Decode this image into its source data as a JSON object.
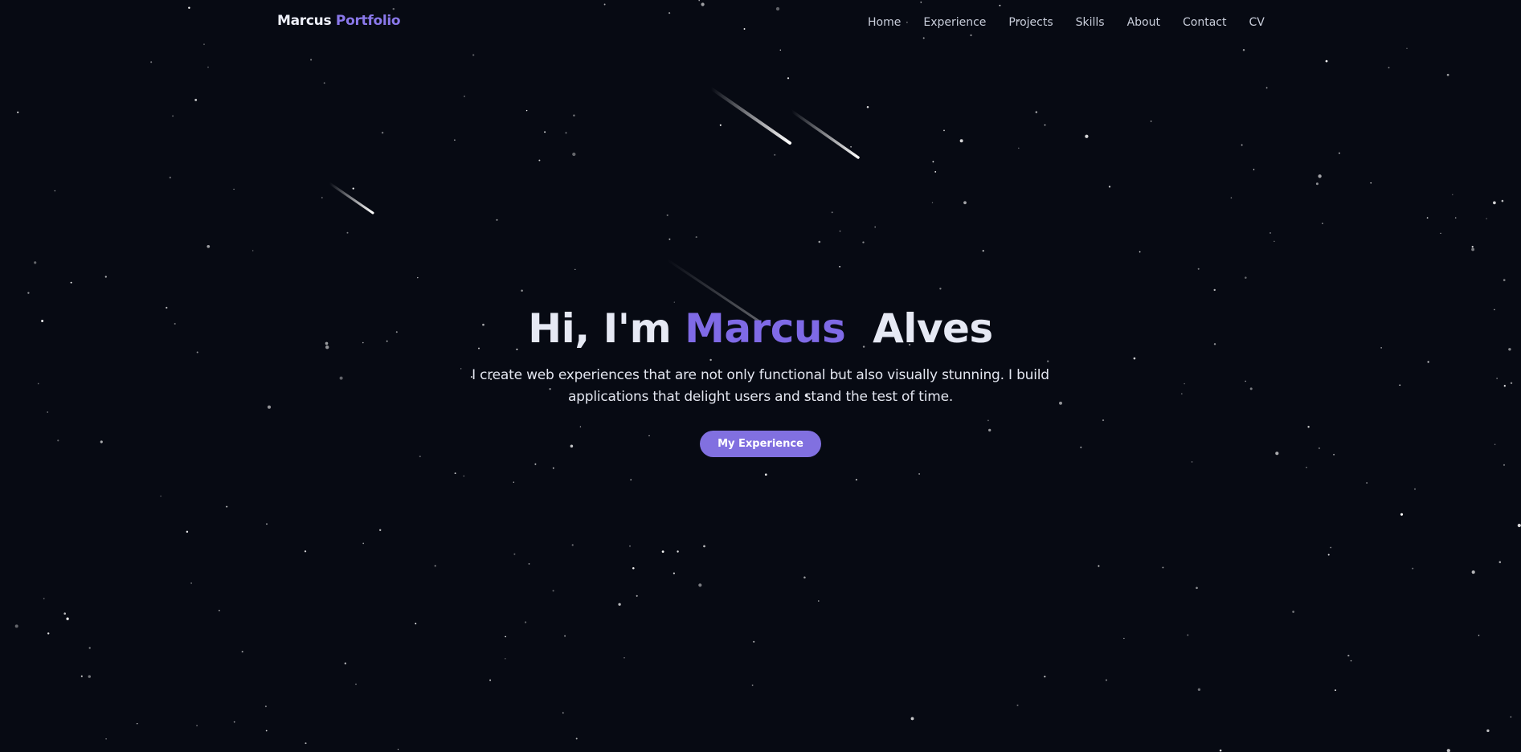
{
  "brand": {
    "first": "Marcus",
    "second": "Portfolio"
  },
  "nav": {
    "links": [
      "Home",
      "Experience",
      "Projects",
      "Skills",
      "About",
      "Contact",
      "CV"
    ]
  },
  "hero": {
    "greeting": "Hi, I'm",
    "first_name": "Marcus",
    "last_name": "Alves",
    "description": "I create web experiences that are not only functional but also visually stunning. I build applications that delight users and stand the test of time.",
    "cta_label": "My Experience"
  },
  "colors": {
    "background": "#070a13",
    "accent": "#8a78ea",
    "button": "#8170e0",
    "text": "#e6e9f4"
  }
}
